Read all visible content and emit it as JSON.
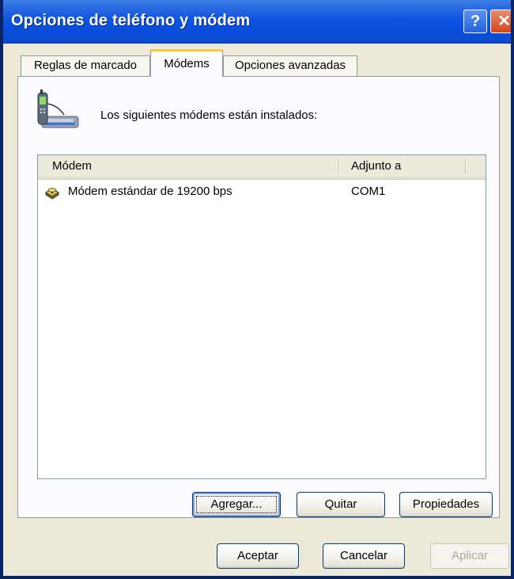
{
  "window": {
    "title": "Opciones de teléfono y módem",
    "help_glyph": "?",
    "close_glyph": "✕"
  },
  "tabs": [
    {
      "label": "Reglas de marcado",
      "selected": false
    },
    {
      "label": "Módems",
      "selected": true
    },
    {
      "label": "Opciones avanzadas",
      "selected": false
    }
  ],
  "modems_tab": {
    "icon": "phone-modem-icon",
    "intro": "Los siguientes módems están instalados:",
    "columns": [
      "Módem",
      "Adjunto a"
    ],
    "rows": [
      {
        "icon": "modem-icon",
        "modem": "Módem estándar de 19200 bps",
        "port": "COM1"
      }
    ],
    "buttons": {
      "add": "Agregar...",
      "remove": "Quitar",
      "properties": "Propiedades"
    }
  },
  "dialog_buttons": {
    "ok": "Aceptar",
    "cancel": "Cancelar",
    "apply": "Aplicar",
    "apply_enabled": false
  },
  "colors": {
    "titlebar": "#0A4DDB",
    "dialog_bg": "#ECE9D8",
    "selected_tab_accent": "#FFC83C",
    "disabled_text": "#ACA899"
  }
}
